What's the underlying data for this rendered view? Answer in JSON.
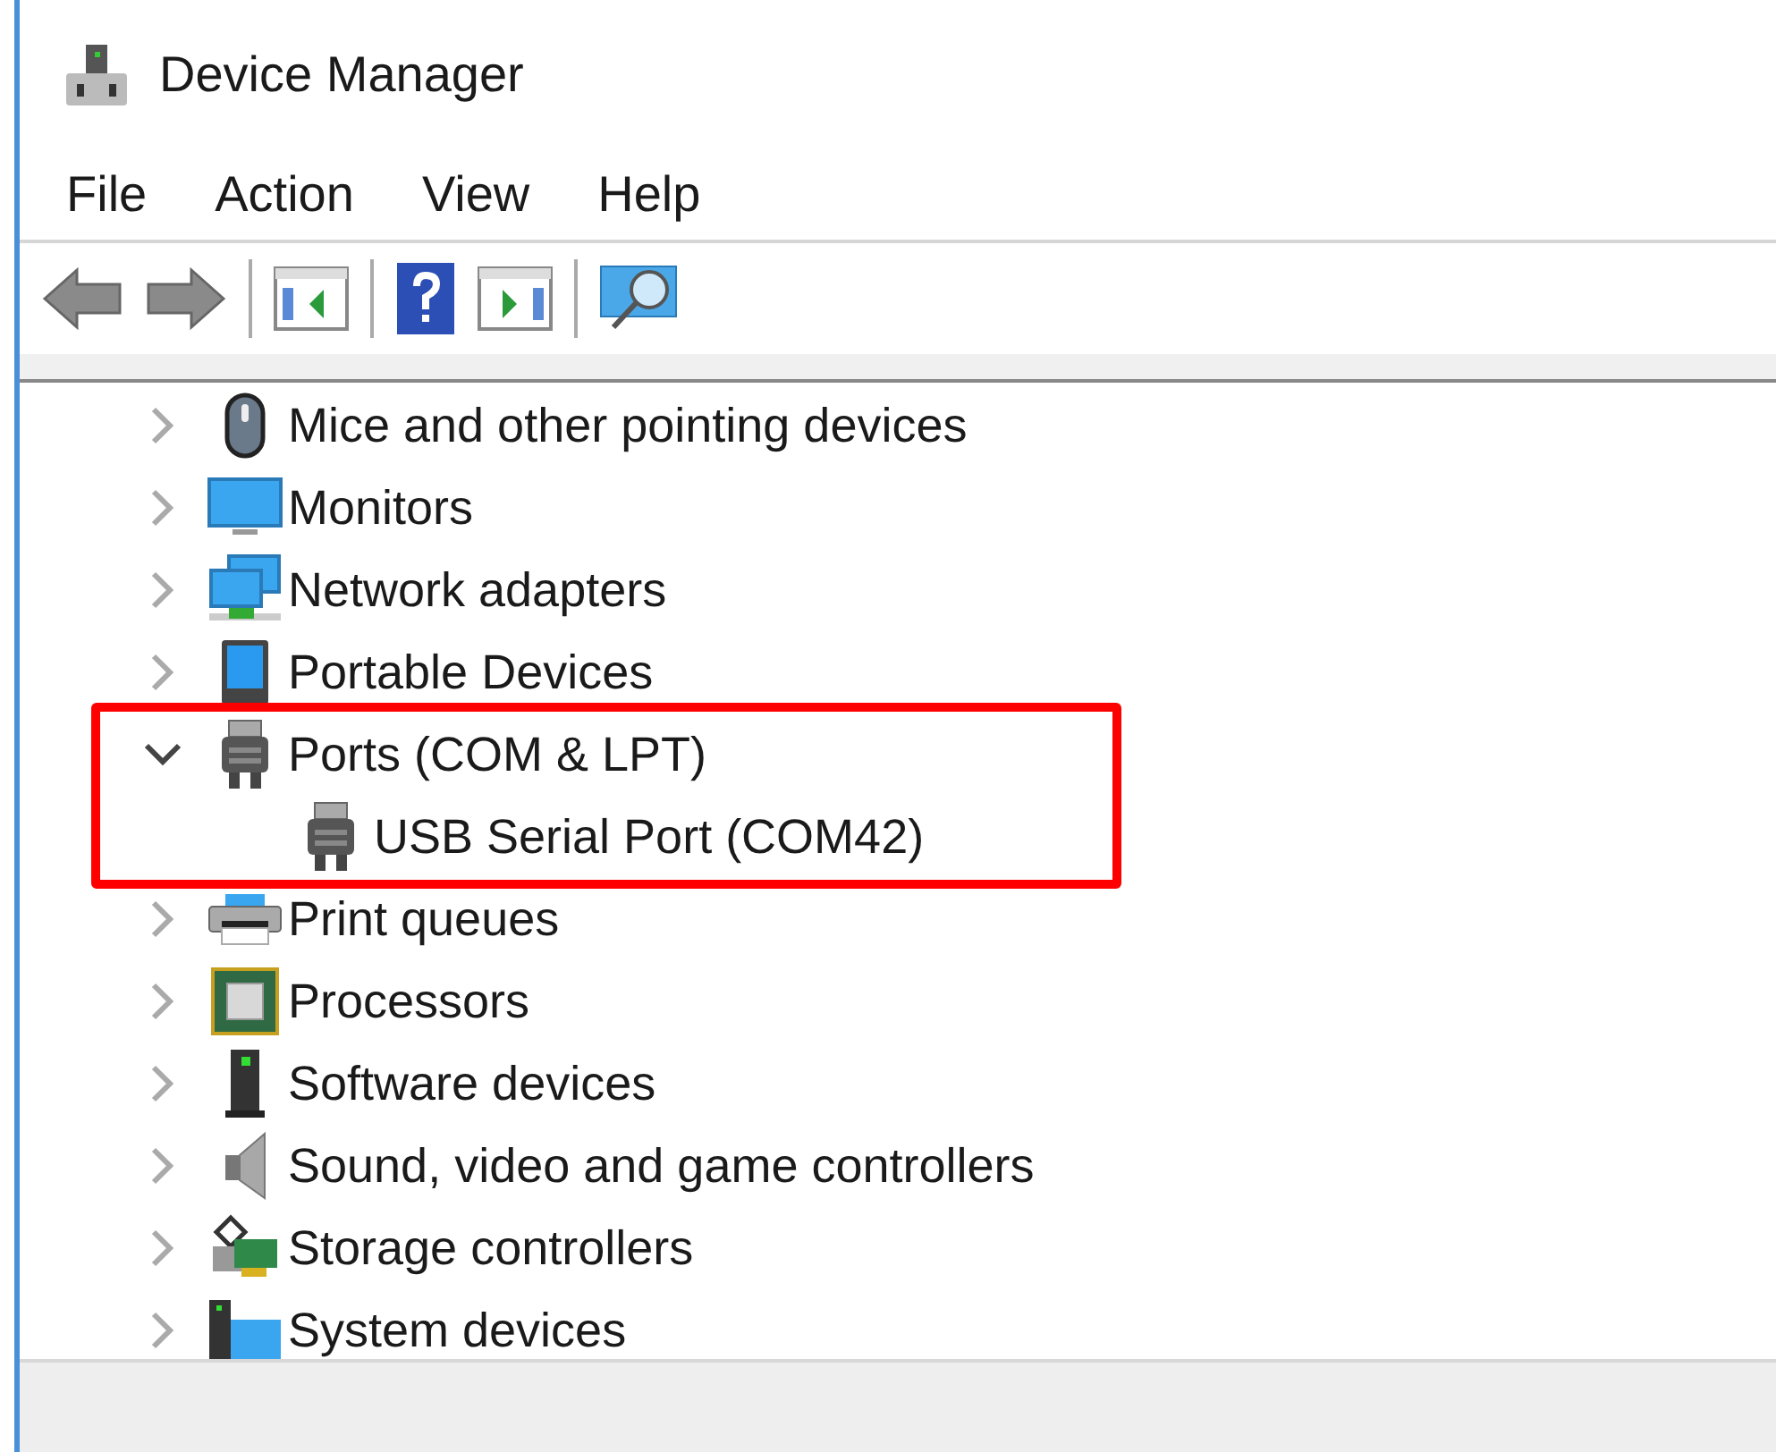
{
  "window": {
    "title": "Device Manager"
  },
  "menu": [
    "File",
    "Action",
    "View",
    "Help"
  ],
  "tree": [
    {
      "label": "Mice and other pointing devices",
      "expanded": false,
      "highlighted": false
    },
    {
      "label": "Monitors",
      "expanded": false,
      "highlighted": false
    },
    {
      "label": "Network adapters",
      "expanded": false,
      "highlighted": false
    },
    {
      "label": "Portable Devices",
      "expanded": false,
      "highlighted": false
    },
    {
      "label": "Ports (COM & LPT)",
      "expanded": true,
      "highlighted": true,
      "children": [
        {
          "label": "USB Serial Port (COM42)"
        }
      ]
    },
    {
      "label": "Print queues",
      "expanded": false,
      "highlighted": false
    },
    {
      "label": "Processors",
      "expanded": false,
      "highlighted": false
    },
    {
      "label": "Software devices",
      "expanded": false,
      "highlighted": false
    },
    {
      "label": "Sound, video and game controllers",
      "expanded": false,
      "highlighted": false
    },
    {
      "label": "Storage controllers",
      "expanded": false,
      "highlighted": false
    },
    {
      "label": "System devices",
      "expanded": false,
      "highlighted": false
    }
  ]
}
